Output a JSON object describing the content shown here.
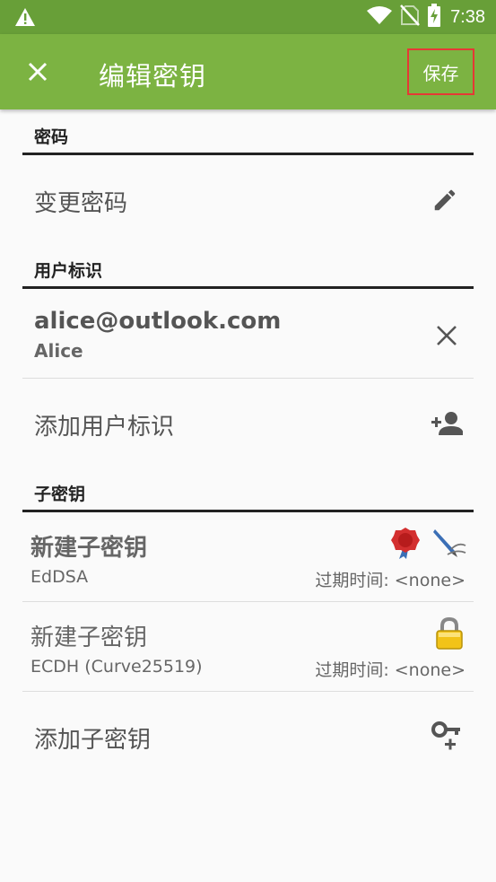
{
  "status_bar": {
    "time": "7:38",
    "icons": [
      "warning-icon",
      "wifi-icon",
      "no-sim-icon",
      "battery-charging-icon"
    ]
  },
  "app_bar": {
    "title": "编辑密钥",
    "save_label": "保存",
    "close_icon": "close-icon"
  },
  "password_section": {
    "header": "密码",
    "change_password_label": "变更密码",
    "icon": "edit-icon"
  },
  "user_ids_section": {
    "header": "用户标识",
    "items": [
      {
        "email": "alice@outlook.com",
        "name": "Alice",
        "icon": "remove-icon"
      }
    ],
    "add_label": "添加用户标识",
    "add_icon": "add-person-icon"
  },
  "subkeys_section": {
    "header": "子密钥",
    "items": [
      {
        "title": "新建子密钥",
        "algorithm": "EdDSA",
        "expiry": "过期时间: <none>",
        "icons": [
          "certify-seal-icon",
          "sign-pen-icon"
        ]
      },
      {
        "title": "新建子密钥",
        "algorithm": "ECDH (Curve25519)",
        "expiry": "过期时间: <none>",
        "icons": [
          "encrypt-lock-icon"
        ]
      }
    ],
    "add_label": "添加子密钥",
    "add_icon": "add-key-icon"
  },
  "colors": {
    "status_bar": "#689f38",
    "app_bar": "#7cb342",
    "save_border": "#e53935",
    "background": "#fafafa"
  }
}
